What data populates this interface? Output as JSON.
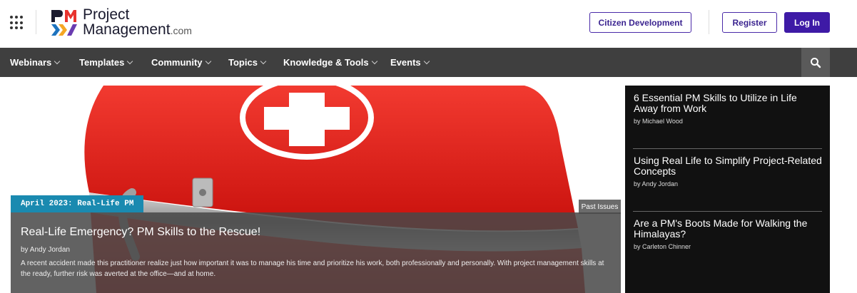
{
  "header": {
    "logo": {
      "line1": "Project",
      "line2": "Management",
      "suffix": ".com"
    },
    "citizen_label": "Citizen Development",
    "register_label": "Register",
    "login_label": "Log In"
  },
  "nav": {
    "items": [
      {
        "label": "Webinars"
      },
      {
        "label": "Templates"
      },
      {
        "label": "Community"
      },
      {
        "label": "Topics"
      },
      {
        "label": "Knowledge & Tools"
      },
      {
        "label": "Events"
      }
    ]
  },
  "hero": {
    "issue_tag": "April 2023: Real-Life PM",
    "past_issues": "Past Issues",
    "title": "Real-Life Emergency? PM Skills to the Rescue!",
    "author": "by Andy Jordan",
    "description": "A recent accident made this practitioner realize just how important it was to manage his time and prioritize his work, both professionally and personally. With project management skills at the ready, further risk was averted at the office—and at home."
  },
  "sidebar": {
    "articles": [
      {
        "title": "6 Essential PM Skills to Utilize in Life Away from Work",
        "author": "by Michael Wood"
      },
      {
        "title": "Using Real Life to Simplify Project-Related Concepts",
        "author": "by Andy Jordan"
      },
      {
        "title": "Are a PM's Boots Made for Walking the Himalayas?",
        "author": "by Carleton Chinner"
      }
    ]
  },
  "colors": {
    "brand_purple": "#3e1aa6",
    "nav_bg": "#3f3f3f",
    "tag_blue": "#1a8ab0",
    "logo_red": "#e8332e",
    "logo_blue": "#1e73be",
    "sidebar_bg": "#111111"
  },
  "icons": {
    "apps": "grid-icon",
    "search": "search-icon",
    "chevron": "chevron-down-icon"
  }
}
